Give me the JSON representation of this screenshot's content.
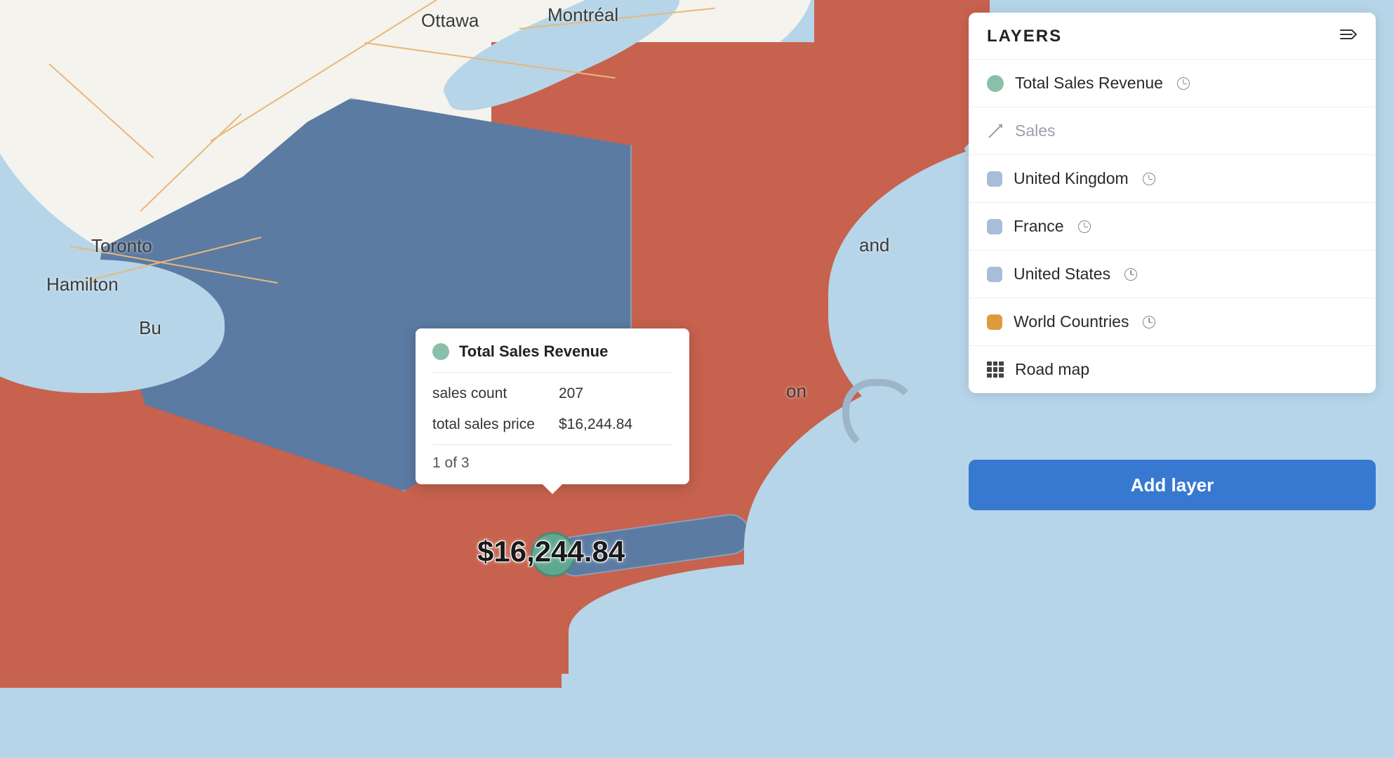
{
  "map": {
    "labels": {
      "toronto": "Toronto",
      "hamilton": "Hamilton",
      "buffalo": "Bu",
      "ottawa": "Ottawa",
      "montreal": "Montréal",
      "portland_fragment": "and",
      "boston_fragment": "on"
    },
    "bubble_value": "$16,244.84"
  },
  "tooltip": {
    "title": "Total Sales Revenue",
    "rows": [
      {
        "key": "sales count",
        "value": "207"
      },
      {
        "key": "total sales price",
        "value": "$16,244.84"
      }
    ],
    "pagination": "1 of 3"
  },
  "layers_panel": {
    "title": "LAYERS",
    "items": [
      {
        "label": "Total Sales Revenue",
        "swatch_color": "#8abfa9",
        "shape": "circle",
        "has_clock": true
      },
      {
        "label": "Sales",
        "shape": "line",
        "muted": true,
        "has_clock": false
      },
      {
        "label": "United Kingdom",
        "swatch_color": "#a8bdd9",
        "shape": "square",
        "has_clock": true
      },
      {
        "label": "France",
        "swatch_color": "#a8bdd9",
        "shape": "square",
        "has_clock": true
      },
      {
        "label": "United States",
        "swatch_color": "#a8bdd9",
        "shape": "square",
        "has_clock": true
      },
      {
        "label": "World Countries",
        "swatch_color": "#e09a3e",
        "shape": "square",
        "has_clock": true
      },
      {
        "label": "Road map",
        "shape": "grid",
        "has_clock": false
      }
    ]
  },
  "add_layer_button": "Add layer",
  "colors": {
    "water": "#b6d5e8",
    "land_neutral": "#f5f3ed",
    "region_red": "#c7624e",
    "region_blue": "#5b7ba3",
    "accent_green": "#8abfa9",
    "accent_orange": "#e09a3e",
    "primary_button": "#3779d0"
  }
}
